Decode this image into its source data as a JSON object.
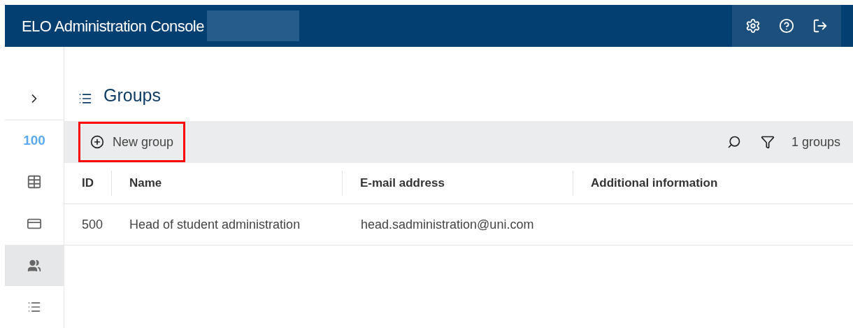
{
  "header": {
    "title": "ELO Administration Console"
  },
  "sidebar": {
    "items": [
      {
        "kind": "expand",
        "selected": false
      },
      {
        "kind": "count",
        "label": "100",
        "selected": false
      },
      {
        "kind": "table",
        "selected": false
      },
      {
        "kind": "card",
        "selected": false
      },
      {
        "kind": "users",
        "selected": true
      },
      {
        "kind": "list",
        "selected": false
      }
    ]
  },
  "page": {
    "title": "Groups"
  },
  "toolbar": {
    "new_button": "New group",
    "count": "1 groups"
  },
  "table": {
    "columns": [
      "ID",
      "Name",
      "E-mail address",
      "Additional information"
    ],
    "rows": [
      [
        "500",
        "Head of student administration",
        "head.sadministration@uni.com",
        ""
      ]
    ]
  }
}
